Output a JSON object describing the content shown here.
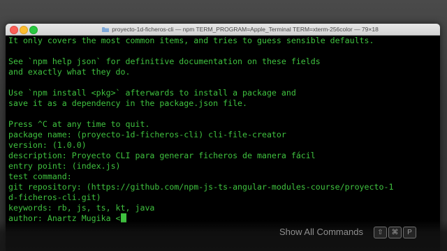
{
  "window": {
    "title": "proyecto-1d-ficheros-cli — npm TERM_PROGRAM=Apple_Terminal TERM=xterm-256color — 79×18"
  },
  "terminal": {
    "lines": [
      "It only covers the most common items, and tries to guess sensible defaults.",
      "",
      "See `npm help json` for definitive documentation on these fields",
      "and exactly what they do.",
      "",
      "Use `npm install <pkg>` afterwards to install a package and",
      "save it as a dependency in the package.json file.",
      "",
      "Press ^C at any time to quit.",
      "package name: (proyecto-1d-ficheros-cli) cli-file-creator",
      "version: (1.0.0)",
      "description: Proyecto CLI para generar ficheros de manera fácil",
      "entry point: (index.js)",
      "test command:",
      "git repository: (https://github.com/npm-js-ts-angular-modules-course/proyecto-1",
      "d-ficheros-cli.git)",
      "keywords: rb, js, ts, kt, java",
      "author: Anartz Mugika <"
    ],
    "text_color": "#3fc23f",
    "background": "#000000"
  },
  "overlay": {
    "show_all_label": "Show All Commands",
    "keys": [
      "⇧",
      "⌘",
      "P"
    ]
  },
  "icons": {
    "folder": "folder-icon"
  }
}
